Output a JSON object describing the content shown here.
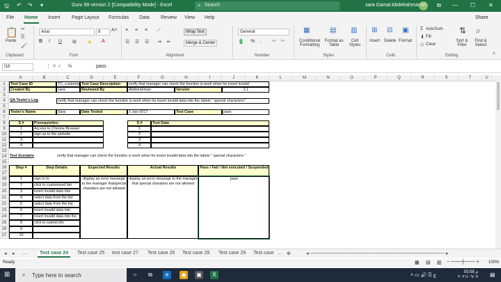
{
  "titlebar": {
    "title": "Guru 99 version 2  [Compatibility Mode]  -  Excel",
    "search_placeholder": "Search",
    "user": "sara  Gamal Abdelrahman",
    "avatar": "SG"
  },
  "menu": {
    "tabs": [
      "File",
      "Home",
      "Insert",
      "Page Layout",
      "Formulas",
      "Data",
      "Review",
      "View",
      "Help"
    ],
    "active": "Home",
    "share": "Share"
  },
  "ribbon": {
    "font_name": "Arial",
    "font_size": "8",
    "number_format": "General",
    "wrap_text": "Wrap Text",
    "merge_center": "Merge & Center",
    "paste": "Paste",
    "conditional": "Conditional Formatting",
    "format_as_table": "Format as Table",
    "cell_styles": "Cell Styles",
    "insert": "Insert",
    "delete": "Delete",
    "format": "Format",
    "autosum": "AutoSum",
    "fill": "Fill",
    "clear": "Clear",
    "sort_filter": "Sort & Filter",
    "find_select": "Find & Select",
    "groups": [
      "Clipboard",
      "Font",
      "Alignment",
      "Number",
      "Styles",
      "Cells",
      "Editing"
    ]
  },
  "formula_bar": {
    "name_box": "I18",
    "fx": "fx",
    "value": "pass"
  },
  "columns": [
    "A",
    "B",
    "C",
    "D",
    "E",
    "F",
    "G",
    "H",
    "I",
    "J",
    "K",
    "L",
    "M",
    "N",
    "O",
    "P",
    "Q",
    "R",
    "S",
    "T",
    "U"
  ],
  "rows": [
    "1",
    "2",
    "3",
    "4",
    "5",
    "6",
    "7",
    "8",
    "9",
    "10",
    "11",
    "12",
    "13",
    "14",
    "15",
    "16",
    "17",
    "18",
    "19",
    "20",
    "21",
    "22",
    "23",
    "24",
    "25",
    "26",
    "27"
  ],
  "cells": {
    "a1": "Test Case ID",
    "c1": "TC_customiz",
    "d1": "Test Case Description",
    "f1": "verify that manager can check the function is work when he insert invalid",
    "a2": "Created By",
    "c2": "sara",
    "d2": "Reviewed By",
    "f2": "Abdelrahman",
    "h2": "Version",
    "j2": "2.1",
    "a4": "QA Tester's Log",
    "c4": "verify that manager can check the function is work when he insert invalid data into the labels \" special characters\"",
    "a6": "Tester's Name",
    "c6": "Sara",
    "d6": "Date Tested",
    "f6": "1-Jan-2017",
    "h6": "Test Case",
    "j6": "pass",
    "a8": "S #",
    "b8": "Prerequisites:",
    "f8": "S #",
    "g8": "Test Data",
    "pre": [
      {
        "n": "1",
        "t": "Access to Chrome Browser"
      },
      {
        "n": "2",
        "t": "sign up to the website"
      },
      {
        "n": "3",
        "t": ""
      },
      {
        "n": "4",
        "t": ""
      }
    ],
    "td": [
      "1",
      "2",
      "3",
      "4"
    ],
    "a14": "Test Scenario",
    "c14": "verify that manager can check the function is work when he insert invalid data into the labels \" special characters \"",
    "h_step": "Step #",
    "h_details": "Step Details",
    "h_expected": "Expected Results",
    "h_actual": "Actual Results",
    "h_status": "Pass / Fail / Not executed / Suspended",
    "steps": [
      {
        "n": "1",
        "t": "sign in to"
      },
      {
        "n": "2",
        "t": "click to customized btn"
      },
      {
        "n": "3",
        "t": "insert invalid data into"
      },
      {
        "n": "4",
        "t": "select data from the list"
      },
      {
        "n": "5",
        "t": "select data from the list"
      },
      {
        "n": "6",
        "t": "insert invalid data into"
      },
      {
        "n": "7",
        "t": "insert invalid data into the"
      },
      {
        "n": "8",
        "t": "click to submit btn"
      },
      {
        "n": "9",
        "t": ""
      },
      {
        "n": "10",
        "t": ""
      }
    ],
    "expected": "display an error messege to the manager thatspecial  charaters are not allowed",
    "actual": "display an error messege to the manager that special charaters are not allowed",
    "status": "pass"
  },
  "sheet_tabs": [
    "Test case 24",
    "Test case 25",
    "test case 27",
    "Test case 26",
    "Test case 28",
    "Test case 29",
    "Test case"
  ],
  "active_sheet": "Test case 24",
  "status_bar": {
    "ready": "Ready",
    "zoom": "100%"
  },
  "taskbar": {
    "search": "Type here to search",
    "time": "03:58 م",
    "date": "٢٠٢١/٠٦/٠٧"
  }
}
